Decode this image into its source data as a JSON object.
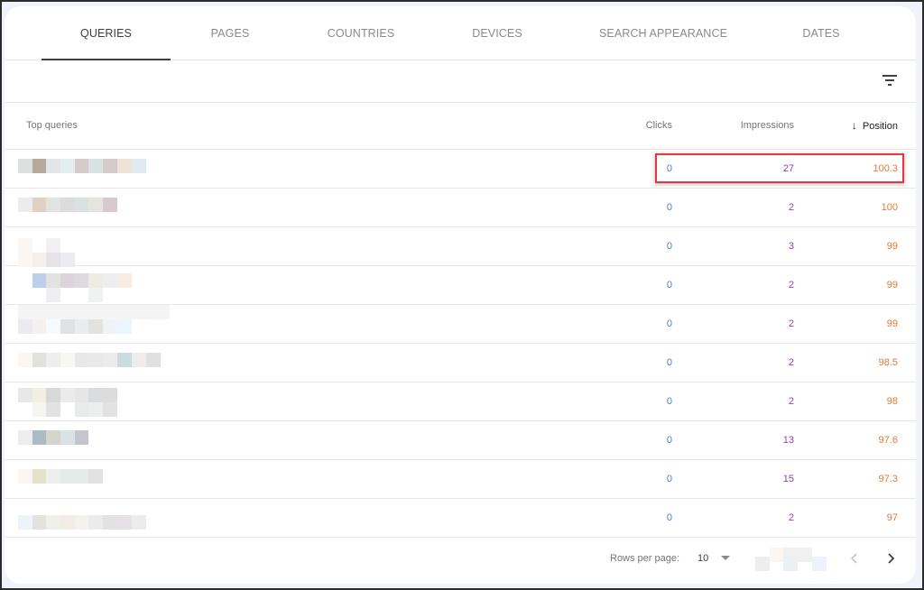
{
  "tabs": [
    {
      "label": "QUERIES",
      "active": true
    },
    {
      "label": "PAGES",
      "active": false
    },
    {
      "label": "COUNTRIES",
      "active": false
    },
    {
      "label": "DEVICES",
      "active": false
    },
    {
      "label": "SEARCH APPEARANCE",
      "active": false
    },
    {
      "label": "DATES",
      "active": false
    }
  ],
  "toolbar": {
    "filter_icon": "filter-icon"
  },
  "table": {
    "headers": {
      "query": "Top queries",
      "clicks": "Clicks",
      "impressions": "Impressions",
      "position": "Position",
      "sort_icon": "arrow-down-icon"
    },
    "rows": [
      {
        "query": "[redacted]",
        "clicks": "0",
        "impressions": "27",
        "position": "100.3",
        "highlighted": true
      },
      {
        "query": "[redacted]",
        "clicks": "0",
        "impressions": "2",
        "position": "100"
      },
      {
        "query": "[redacted]",
        "clicks": "0",
        "impressions": "3",
        "position": "99"
      },
      {
        "query": "[redacted]",
        "clicks": "0",
        "impressions": "2",
        "position": "99"
      },
      {
        "query": "[redacted]",
        "clicks": "0",
        "impressions": "2",
        "position": "99"
      },
      {
        "query": "[redacted]",
        "clicks": "0",
        "impressions": "2",
        "position": "98.5"
      },
      {
        "query": "[redacted]",
        "clicks": "0",
        "impressions": "2",
        "position": "98"
      },
      {
        "query": "[redacted]",
        "clicks": "0",
        "impressions": "13",
        "position": "97.6"
      },
      {
        "query": "[redacted]",
        "clicks": "0",
        "impressions": "15",
        "position": "97.3"
      },
      {
        "query": "[redacted]",
        "clicks": "0",
        "impressions": "2",
        "position": "97"
      }
    ]
  },
  "footer": {
    "rows_per_page_label": "Rows per page:",
    "rows_per_page_value": "10",
    "page_range": "[redacted]",
    "prev_icon": "chevron-left-icon",
    "next_icon": "chevron-right-icon"
  },
  "colors": {
    "clicks": "#4a7fd0",
    "impressions": "#8e44ad",
    "position": "#e07b35",
    "highlight": "#e8383d"
  }
}
